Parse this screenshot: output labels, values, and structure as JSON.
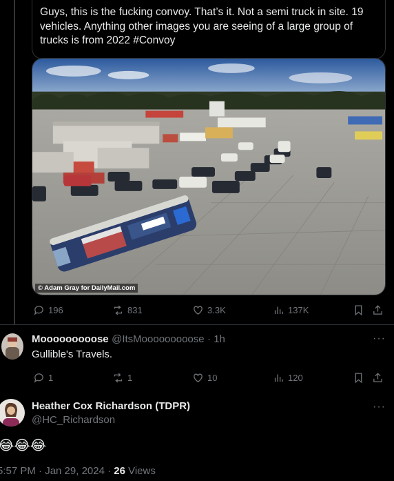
{
  "quoted_tweet": {
    "text": "Guys, this is the fucking convoy. That’s it. Not a semi truck in site. 19 vehicles. Anything other images you are seeing of a large group of trucks is from 2022 #Convoy",
    "photo_credit": "© Adam Gray for DailyMail.com",
    "stats": {
      "replies": "196",
      "retweets": "831",
      "likes": "3.3K",
      "views": "137K"
    }
  },
  "reply": {
    "name": "Mooooooooose",
    "handle": "@ItsMooooooooose",
    "time": "· 1h",
    "text": "Gullible's Travels.",
    "stats": {
      "replies": "1",
      "retweets": "1",
      "likes": "10",
      "views": "120"
    }
  },
  "main_tweet": {
    "name": "Heather Cox Richardson (TDPR)",
    "handle": "@HC_Richardson",
    "emojis": "😂😂😂",
    "timestamp": "5:57 PM · Jan 29, 2024 · ",
    "views_count": "26",
    "views_label": " Views"
  },
  "icons": [
    "reply-icon",
    "retweet-icon",
    "like-icon",
    "views-icon",
    "bookmark-icon",
    "share-icon",
    "more-icon"
  ],
  "colors": {
    "background": "#000000",
    "text": "#e7e9ea",
    "muted": "#71767b",
    "border": "#2f3336"
  }
}
